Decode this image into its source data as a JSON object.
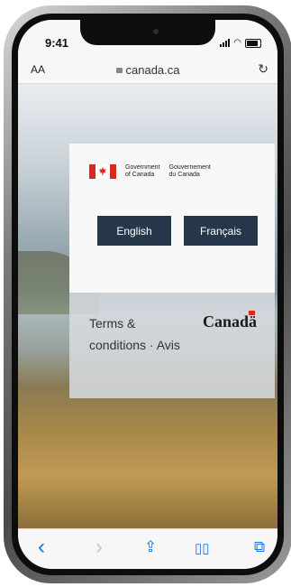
{
  "status": {
    "time": "9:41"
  },
  "browser": {
    "text_size": "AA",
    "url": "canada.ca",
    "reload_icon": "reload-icon"
  },
  "splash": {
    "wordmark_en_line1": "Government",
    "wordmark_en_line2": "of Canada",
    "wordmark_fr_line1": "Gouvernement",
    "wordmark_fr_line2": "du Canada",
    "english_button": "English",
    "french_button": "Français",
    "terms_link": "Terms & conditions · Avis",
    "canada_wordmark": "Canadä"
  },
  "toolbar": {
    "items": [
      {
        "icon": "back-icon",
        "glyph": "‹"
      },
      {
        "icon": "forward-icon",
        "glyph": "›"
      },
      {
        "icon": "share-icon",
        "glyph": "⇪"
      },
      {
        "icon": "bookmarks-icon",
        "glyph": "📖"
      },
      {
        "icon": "tabs-icon",
        "glyph": "⧉"
      }
    ]
  },
  "colors": {
    "button_bg": "#26374a",
    "flag_red": "#d52b1e",
    "link_blue": "#1a73e8"
  }
}
